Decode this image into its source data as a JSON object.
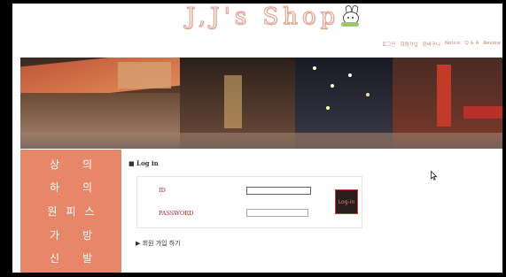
{
  "header": {
    "logo_text": "J,J's Shop"
  },
  "topnav": {
    "items": [
      {
        "label": "로그인"
      },
      {
        "label": "회원가입"
      },
      {
        "label": "장바구니"
      },
      {
        "label": "Notice"
      },
      {
        "label": "Q & A"
      },
      {
        "label": "Review"
      }
    ]
  },
  "sidebar": {
    "rows": [
      [
        "상",
        "의"
      ],
      [
        "하",
        "의"
      ],
      [
        "원",
        "피",
        "스"
      ],
      [
        "가",
        "방"
      ],
      [
        "신",
        "발"
      ]
    ]
  },
  "login": {
    "title": "■ Log in",
    "id_label": "ID",
    "password_label": "PASSWORD",
    "id_value": "",
    "password_value": "",
    "button_label": "Log-in",
    "join_link": "▶ 회원 가입 하기"
  },
  "colors": {
    "sidebar_bg": "#e8866a",
    "label_red": "#9a2424",
    "nav_text": "#c8826e"
  }
}
